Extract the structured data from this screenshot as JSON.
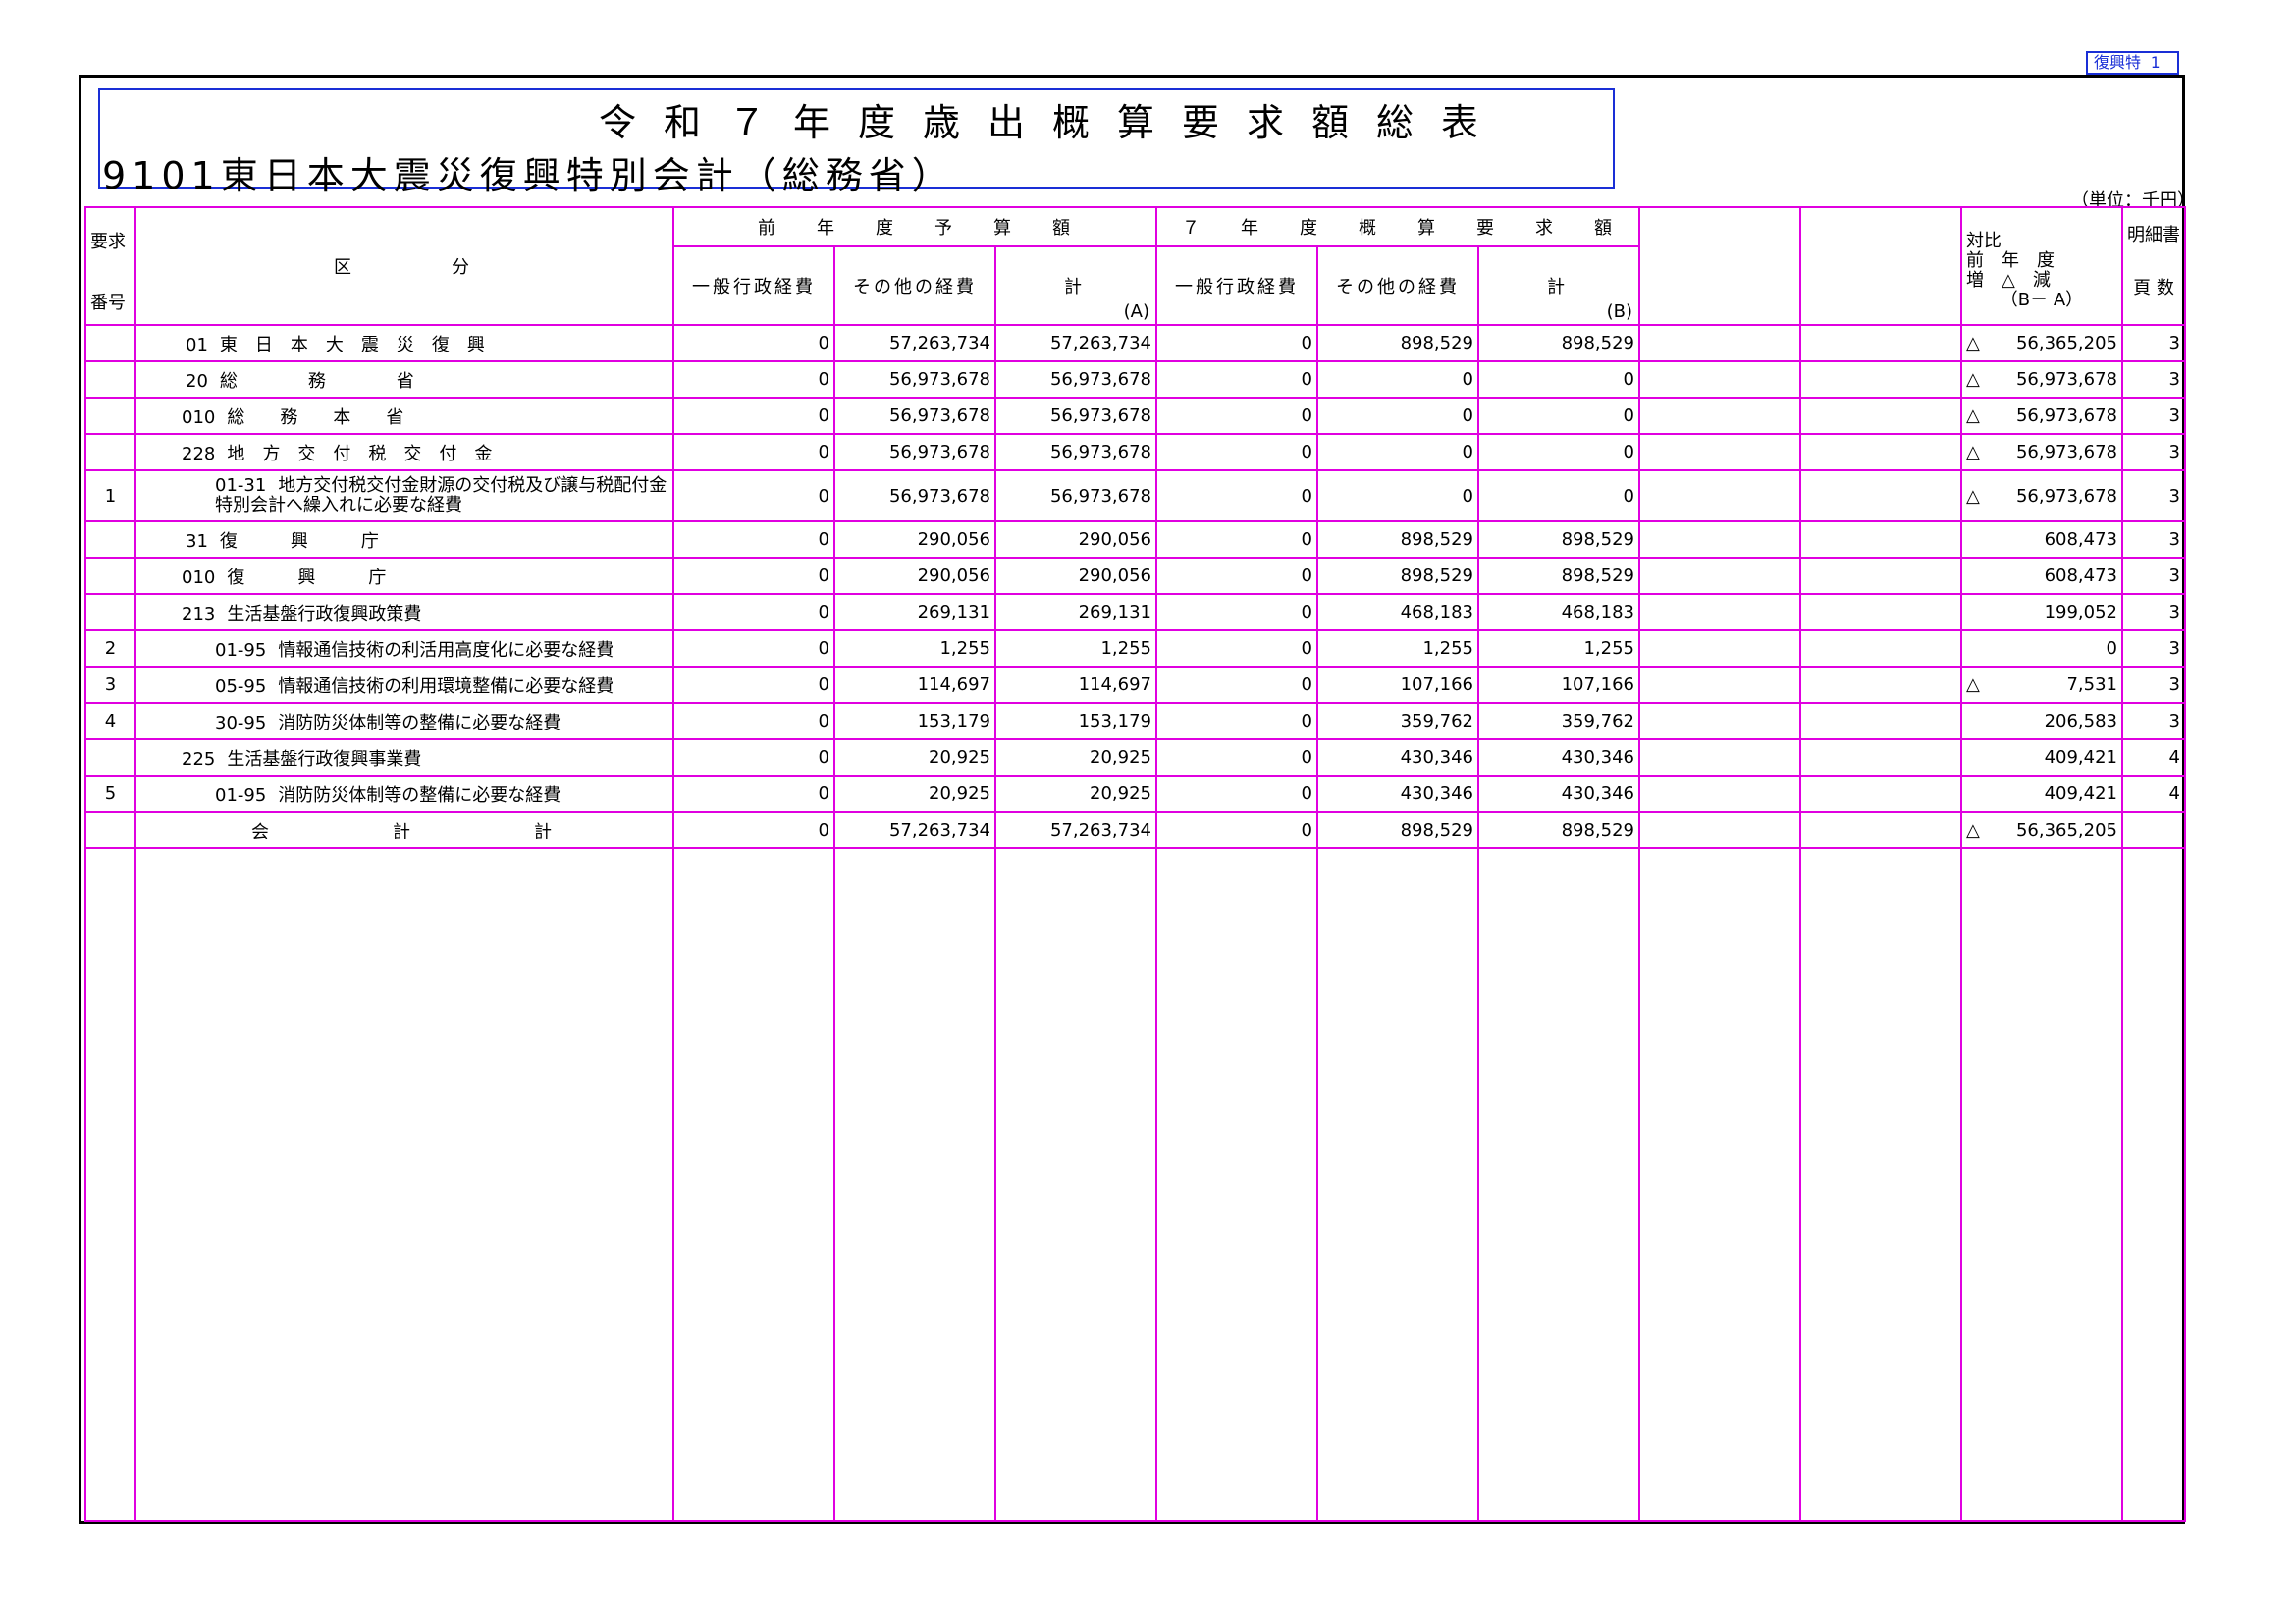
{
  "page_tag": "復興特 1",
  "title": "令和７年度歳出概算要求額総表",
  "subtitle": "9101東日本大震災復興特別会計（総務省）",
  "unit": "（単位：千円）",
  "headers": {
    "req_no": [
      "要求",
      "番号"
    ],
    "division": "区　　　　分",
    "prev_year": "前　　年　　度　　予　　算　　額",
    "r7": "７　　年　　度　　概　　算　　要　　求　　額",
    "general": "一般行政経費",
    "other": "その他の経費",
    "total_a": "計",
    "mark_a": "(A)",
    "total_b": "計",
    "mark_b": "(B)",
    "diff": [
      "対比",
      "前　年　度",
      "増　△　減",
      "（B－ A）"
    ],
    "detail": [
      "明細書",
      "頁 数"
    ]
  },
  "rows": [
    {
      "no": "",
      "code": "01",
      "name": "東　日　本　大　震　災　復　興",
      "p_gen": "0",
      "p_oth": "57,263,734",
      "p_tot": "57,263,734",
      "r_gen": "0",
      "r_oth": "898,529",
      "r_tot": "898,529",
      "neg": "△",
      "diff": "56,365,205",
      "page": "3"
    },
    {
      "no": "",
      "code": "20",
      "name": "総　　　　務　　　　省",
      "p_gen": "0",
      "p_oth": "56,973,678",
      "p_tot": "56,973,678",
      "r_gen": "0",
      "r_oth": "0",
      "r_tot": "0",
      "neg": "△",
      "diff": "56,973,678",
      "page": "3"
    },
    {
      "no": "",
      "code": "010",
      "name": "総　　務　　本　　省",
      "p_gen": "0",
      "p_oth": "56,973,678",
      "p_tot": "56,973,678",
      "r_gen": "0",
      "r_oth": "0",
      "r_tot": "0",
      "neg": "△",
      "diff": "56,973,678",
      "page": "3"
    },
    {
      "no": "",
      "code": "228",
      "name": "地　方　交　付　税　交　付　金",
      "p_gen": "0",
      "p_oth": "56,973,678",
      "p_tot": "56,973,678",
      "r_gen": "0",
      "r_oth": "0",
      "r_tot": "0",
      "neg": "△",
      "diff": "56,973,678",
      "page": "3"
    },
    {
      "no": "1",
      "code": "01-31",
      "name": "地方交付税交付金財源の交付税及び譲与税配付金特別会計へ繰入れに必要な経費",
      "p_gen": "0",
      "p_oth": "56,973,678",
      "p_tot": "56,973,678",
      "r_gen": "0",
      "r_oth": "0",
      "r_tot": "0",
      "neg": "△",
      "diff": "56,973,678",
      "page": "3"
    },
    {
      "no": "",
      "code": "31",
      "name": "復　　　興　　　庁",
      "p_gen": "0",
      "p_oth": "290,056",
      "p_tot": "290,056",
      "r_gen": "0",
      "r_oth": "898,529",
      "r_tot": "898,529",
      "neg": "",
      "diff": "608,473",
      "page": "3"
    },
    {
      "no": "",
      "code": "010",
      "name": "復　　　興　　　庁",
      "p_gen": "0",
      "p_oth": "290,056",
      "p_tot": "290,056",
      "r_gen": "0",
      "r_oth": "898,529",
      "r_tot": "898,529",
      "neg": "",
      "diff": "608,473",
      "page": "3"
    },
    {
      "no": "",
      "code": "213",
      "name": "生活基盤行政復興政策費",
      "p_gen": "0",
      "p_oth": "269,131",
      "p_tot": "269,131",
      "r_gen": "0",
      "r_oth": "468,183",
      "r_tot": "468,183",
      "neg": "",
      "diff": "199,052",
      "page": "3"
    },
    {
      "no": "2",
      "code": "01-95",
      "name": "情報通信技術の利活用高度化に必要な経費",
      "p_gen": "0",
      "p_oth": "1,255",
      "p_tot": "1,255",
      "r_gen": "0",
      "r_oth": "1,255",
      "r_tot": "1,255",
      "neg": "",
      "diff": "0",
      "page": "3"
    },
    {
      "no": "3",
      "code": "05-95",
      "name": "情報通信技術の利用環境整備に必要な経費",
      "p_gen": "0",
      "p_oth": "114,697",
      "p_tot": "114,697",
      "r_gen": "0",
      "r_oth": "107,166",
      "r_tot": "107,166",
      "neg": "△",
      "diff": "7,531",
      "page": "3"
    },
    {
      "no": "4",
      "code": "30-95",
      "name": "消防防災体制等の整備に必要な経費",
      "p_gen": "0",
      "p_oth": "153,179",
      "p_tot": "153,179",
      "r_gen": "0",
      "r_oth": "359,762",
      "r_tot": "359,762",
      "neg": "",
      "diff": "206,583",
      "page": "3"
    },
    {
      "no": "",
      "code": "225",
      "name": "生活基盤行政復興事業費",
      "p_gen": "0",
      "p_oth": "20,925",
      "p_tot": "20,925",
      "r_gen": "0",
      "r_oth": "430,346",
      "r_tot": "430,346",
      "neg": "",
      "diff": "409,421",
      "page": "4"
    },
    {
      "no": "5",
      "code": "01-95",
      "name": "消防防災体制等の整備に必要な経費",
      "p_gen": "0",
      "p_oth": "20,925",
      "p_tot": "20,925",
      "r_gen": "0",
      "r_oth": "430,346",
      "r_tot": "430,346",
      "neg": "",
      "diff": "409,421",
      "page": "4"
    }
  ],
  "total": {
    "label": "会　　　　　計　　　　　計",
    "p_gen": "0",
    "p_oth": "57,263,734",
    "p_tot": "57,263,734",
    "r_gen": "0",
    "r_oth": "898,529",
    "r_tot": "898,529",
    "neg": "△",
    "diff": "56,365,205",
    "page": ""
  }
}
